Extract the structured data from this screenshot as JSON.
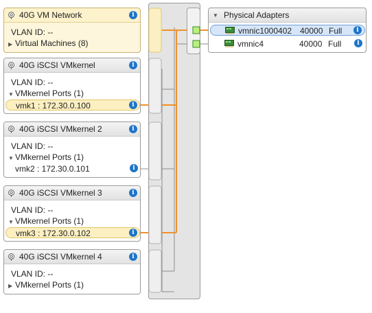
{
  "colors": {
    "accent": "#f0902a",
    "info": "#1f75c9",
    "selected_row": "#fcf0c2",
    "selected_nic": "#d6e6f8"
  },
  "port_groups": [
    {
      "title": "40G VM Network",
      "vlan": "VLAN ID: --",
      "section": "Virtual Machines (8)",
      "expanded": false,
      "selected": true
    },
    {
      "title": "40G iSCSI VMkernel",
      "vlan": "VLAN ID: --",
      "section": "VMkernel Ports (1)",
      "expanded": true,
      "port": {
        "label": "vmk1 : 172.30.0.100",
        "highlighted": true
      }
    },
    {
      "title": "40G iSCSI VMkernel 2",
      "vlan": "VLAN ID: --",
      "section": "VMkernel Ports (1)",
      "expanded": true,
      "port": {
        "label": "vmk2 : 172.30.0.101",
        "highlighted": false
      }
    },
    {
      "title": "40G iSCSI VMkernel 3",
      "vlan": "VLAN ID: --",
      "section": "VMkernel Ports (1)",
      "expanded": true,
      "port": {
        "label": "vmk3 : 172.30.0.102",
        "highlighted": true
      }
    },
    {
      "title": "40G iSCSI VMkernel 4",
      "vlan": "VLAN ID: --",
      "section": "VMkernel Ports (1)",
      "expanded": false
    }
  ],
  "physical_adapters": {
    "title": "Physical Adapters",
    "items": [
      {
        "name": "vmnic1000402",
        "speed": "40000",
        "duplex": "Full",
        "selected": true
      },
      {
        "name": "vmnic4",
        "speed": "40000",
        "duplex": "Full",
        "selected": false
      }
    ]
  }
}
